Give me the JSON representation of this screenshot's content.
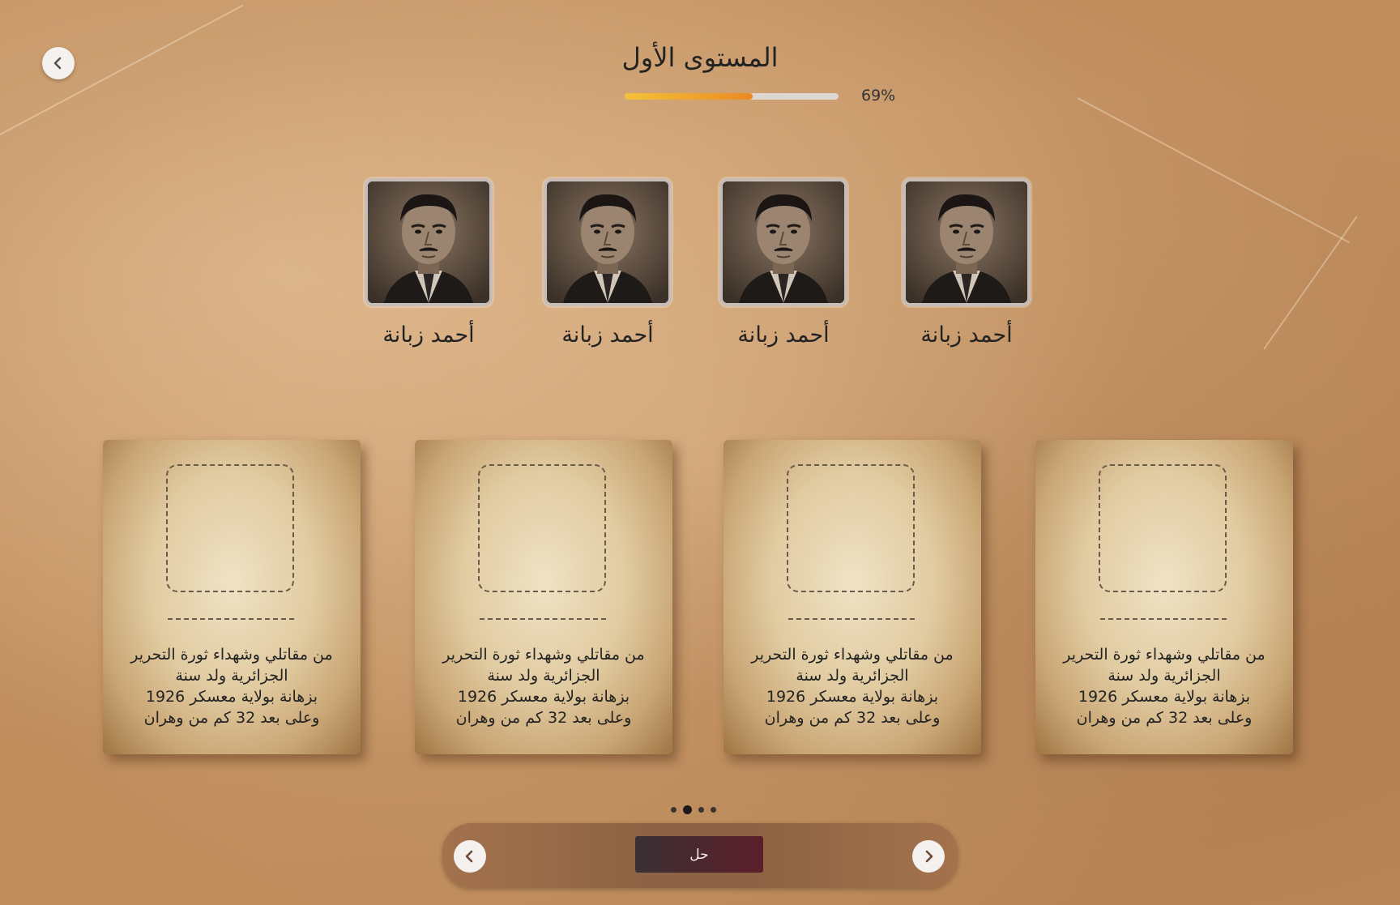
{
  "header": {
    "title": "المستوى الأول",
    "progress_percent": 69,
    "progress_fill": 0.6,
    "progress_label": "69%",
    "back_icon": "chevron-left-icon"
  },
  "portraits": [
    {
      "name": "أحمد زبانة"
    },
    {
      "name": "أحمد زبانة"
    },
    {
      "name": "أحمد زبانة"
    },
    {
      "name": "أحمد زبانة"
    }
  ],
  "cards": [
    {
      "description": "من مقاتلي وشهداء ثورة التحرير\nالجزائرية ولد سنة\n1926 بزهانة بولاية معسكر\nوعلى بعد 32 كم من وهران"
    },
    {
      "description": "من مقاتلي وشهداء ثورة التحرير\nالجزائرية ولد سنة\n1926 بزهانة بولاية معسكر\nوعلى بعد 32 كم من وهران"
    },
    {
      "description": "من مقاتلي وشهداء ثورة التحرير\nالجزائرية ولد سنة\n1926 بزهانة بولاية معسكر\nوعلى بعد 32 كم من وهران"
    },
    {
      "description": "من مقاتلي وشهداء ثورة التحرير\nالجزائرية ولد سنة\n1926 بزهانة بولاية معسكر\nوعلى بعد 32 كم من وهران"
    }
  ],
  "pagination": {
    "total": 4,
    "active_index": 1
  },
  "toolbar": {
    "solve_label": "حل",
    "prev_icon": "chevron-left-icon",
    "next_icon": "chevron-right-icon"
  },
  "colors": {
    "background": "#c99a6a",
    "progress_start": "#f3c238",
    "progress_end": "#ec8a25",
    "solve_button": "#4a2530"
  }
}
